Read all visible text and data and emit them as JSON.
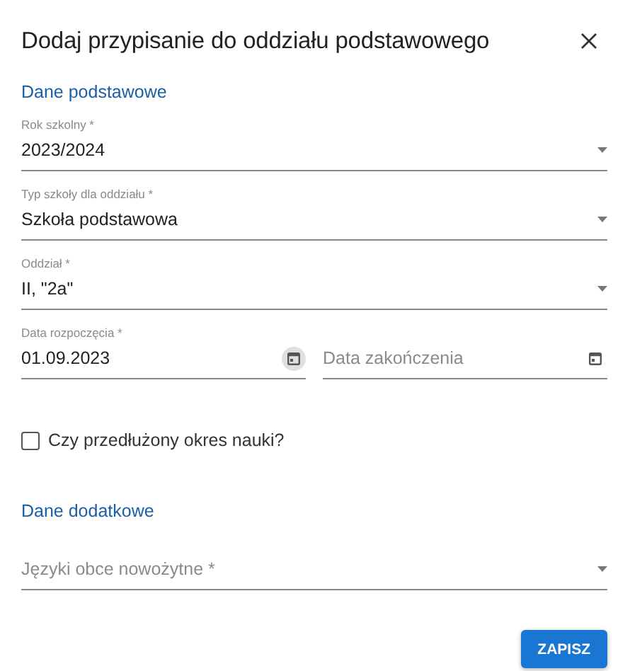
{
  "dialog": {
    "title": "Dodaj przypisanie do oddziału podstawowego"
  },
  "sections": [
    {
      "heading": "Dane podstawowe",
      "rows": [
        {
          "fields": [
            {
              "kind": "select",
              "label": "Rok szkolny *",
              "value": "2023/2024"
            }
          ]
        },
        {
          "fields": [
            {
              "kind": "select",
              "label": "Typ szkoły dla oddziału *",
              "value": "Szkoła podstawowa"
            }
          ]
        },
        {
          "fields": [
            {
              "kind": "select",
              "label": "Oddział *",
              "value": "II, \"2a\""
            }
          ]
        },
        {
          "fields": [
            {
              "kind": "date",
              "label": "Data rozpoczęcia *",
              "value": "01.09.2023",
              "hovered": true
            },
            {
              "kind": "date",
              "placeholder": "Data zakończenia",
              "hovered": false
            }
          ]
        },
        {
          "fields": [
            {
              "kind": "checkbox",
              "label": "Czy przedłużony okres nauki?",
              "checked": false
            }
          ]
        }
      ]
    },
    {
      "heading": "Dane dodatkowe",
      "rows": [
        {
          "fields": [
            {
              "kind": "select",
              "placeholder": "Języki obce nowożytne *"
            }
          ]
        }
      ]
    }
  ],
  "buttons": [
    {
      "label": "ZAPISZ"
    }
  ]
}
